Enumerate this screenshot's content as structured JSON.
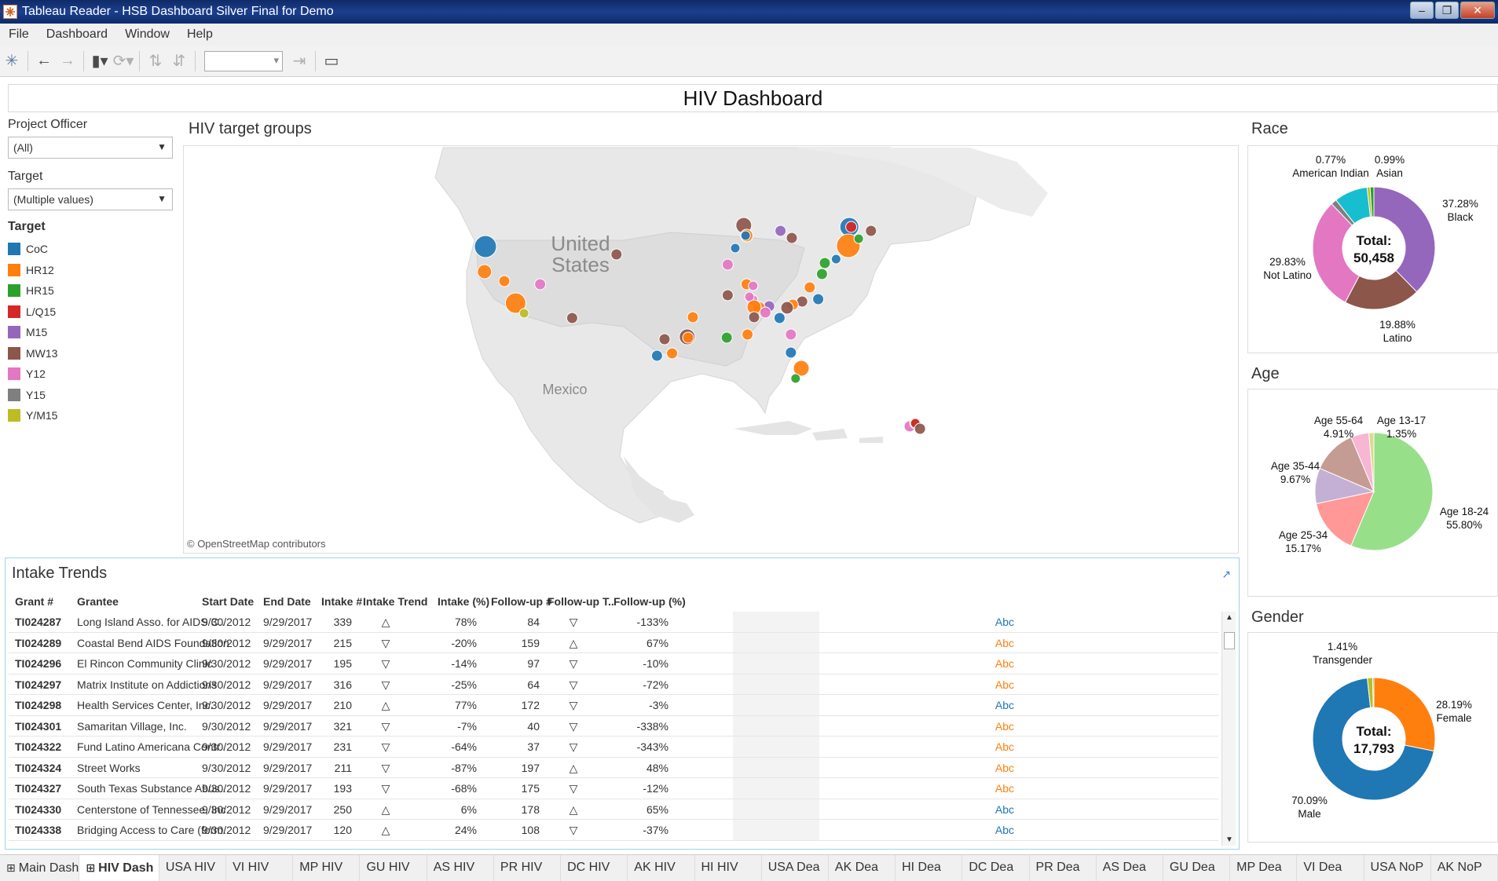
{
  "window": {
    "title": "Tableau Reader - HSB Dashboard Silver Final for Demo"
  },
  "menu": [
    "File",
    "Dashboard",
    "Window",
    "Help"
  ],
  "dashboard": {
    "title": "HIV Dashboard"
  },
  "filters": {
    "project_officer_label": "Project Officer",
    "project_officer_value": "(All)",
    "target_label": "Target",
    "target_value": "(Multiple values)",
    "legend_label": "Target",
    "legend": [
      {
        "name": "CoC",
        "color": "#1f77b4"
      },
      {
        "name": "HR12",
        "color": "#ff7f0e"
      },
      {
        "name": "HR15",
        "color": "#2ca02c"
      },
      {
        "name": "L/Q15",
        "color": "#d62728"
      },
      {
        "name": "M15",
        "color": "#9467bd"
      },
      {
        "name": "MW13",
        "color": "#8c564b"
      },
      {
        "name": "Y12",
        "color": "#e377c2"
      },
      {
        "name": "Y15",
        "color": "#7f7f7f"
      },
      {
        "name": "Y/M15",
        "color": "#bcbd22"
      }
    ]
  },
  "map": {
    "title": "HIV target groups",
    "labels": {
      "us_line1": "United",
      "us_line2": "States",
      "mexico": "Mexico"
    },
    "attribution": "© OpenStreetMap contributors"
  },
  "race": {
    "title": "Race",
    "total_label": "Total:",
    "total_value": "50,458",
    "slices": [
      {
        "name": "Black",
        "pct": "37.28%",
        "value": 37.28,
        "color": "#9467bd"
      },
      {
        "name": "Latino",
        "pct": "19.88%",
        "value": 19.88,
        "color": "#8c564b"
      },
      {
        "name": "Not Latino",
        "pct": "29.83%",
        "value": 29.83,
        "color": "#e377c2"
      },
      {
        "name": "",
        "pct": "",
        "value": 1.5,
        "color": "#7f7f7f"
      },
      {
        "name": "",
        "pct": "",
        "value": 8.75,
        "color": "#17becf"
      },
      {
        "name": "American Indian",
        "pct": "0.77%",
        "value": 0.77,
        "color": "#bcbd22"
      },
      {
        "name": "Asian",
        "pct": "0.99%",
        "value": 0.99,
        "color": "#2ca02c"
      }
    ]
  },
  "age": {
    "title": "Age",
    "slices": [
      {
        "name": "Age 18-24",
        "pct": "55.80%",
        "value": 55.8,
        "color": "#98df8a"
      },
      {
        "name": "Age 25-34",
        "pct": "15.17%",
        "value": 15.17,
        "color": "#ff9896"
      },
      {
        "name": "Age 35-44",
        "pct": "9.67%",
        "value": 9.67,
        "color": "#c5b0d5"
      },
      {
        "name": "",
        "pct": "",
        "value": 12.1,
        "color": "#c49c94"
      },
      {
        "name": "Age 55-64",
        "pct": "4.91%",
        "value": 4.91,
        "color": "#f7b6d2"
      },
      {
        "name": "Age 13-17",
        "pct": "1.35%",
        "value": 1.35,
        "color": "#dbdb8d"
      }
    ]
  },
  "gender": {
    "title": "Gender",
    "total_label": "Total:",
    "total_value": "17,793",
    "slices": [
      {
        "name": "Female",
        "pct": "28.19%",
        "value": 28.19,
        "color": "#ff7f0e"
      },
      {
        "name": "Male",
        "pct": "70.09%",
        "value": 70.09,
        "color": "#1f77b4"
      },
      {
        "name": "Transgender",
        "pct": "1.41%",
        "value": 1.41,
        "color": "#bcbd22"
      },
      {
        "name": "",
        "pct": "",
        "value": 0.31,
        "color": "#2ca02c"
      }
    ]
  },
  "trends": {
    "title": "Intake Trends",
    "columns": [
      "Grant #",
      "Grantee",
      "Start Date",
      "End Date",
      "Intake #",
      "Intake Trend",
      "Intake (%)",
      "Follow-up #",
      "Follow-up T..",
      "Follow-up (%)"
    ],
    "rows": [
      [
        "TI024287",
        "Long Island Asso. for AIDS C..",
        "9/30/2012",
        "9/29/2017",
        "339",
        "△",
        "78%",
        "84",
        "▽",
        "-133%",
        "Abc"
      ],
      [
        "TI024289",
        "Coastal Bend AIDS Foundation",
        "9/30/2012",
        "9/29/2017",
        "215",
        "▽",
        "-20%",
        "159",
        "△",
        "67%",
        "Abc"
      ],
      [
        "TI024296",
        "El Rincon Community Clinic",
        "9/30/2012",
        "9/29/2017",
        "195",
        "▽",
        "-14%",
        "97",
        "▽",
        "-10%",
        "Abc"
      ],
      [
        "TI024297",
        "Matrix Institute on Addictions",
        "9/30/2012",
        "9/29/2017",
        "316",
        "▽",
        "-25%",
        "64",
        "▽",
        "-72%",
        "Abc"
      ],
      [
        "TI024298",
        "Health Services Center, Inc.",
        "9/30/2012",
        "9/29/2017",
        "210",
        "△",
        "77%",
        "172",
        "▽",
        "-3%",
        "Abc"
      ],
      [
        "TI024301",
        "Samaritan Village, Inc.",
        "9/30/2012",
        "9/29/2017",
        "321",
        "▽",
        "-7%",
        "40",
        "▽",
        "-338%",
        "Abc"
      ],
      [
        "TI024322",
        "Fund Latino Americana Contr..",
        "9/30/2012",
        "9/29/2017",
        "231",
        "▽",
        "-64%",
        "37",
        "▽",
        "-343%",
        "Abc"
      ],
      [
        "TI024324",
        "Street Works",
        "9/30/2012",
        "9/29/2017",
        "211",
        "▽",
        "-87%",
        "197",
        "△",
        "48%",
        "Abc"
      ],
      [
        "TI024327",
        "South Texas Substance Abus..",
        "9/30/2012",
        "9/29/2017",
        "193",
        "▽",
        "-68%",
        "175",
        "▽",
        "-12%",
        "Abc"
      ],
      [
        "TI024330",
        "Centerstone of Tennessee, Inc.",
        "9/30/2012",
        "9/29/2017",
        "250",
        "△",
        "6%",
        "178",
        "△",
        "65%",
        "Abc"
      ],
      [
        "TI024338",
        "Bridging Access to Care (form..",
        "9/30/2012",
        "9/29/2017",
        "120",
        "△",
        "24%",
        "108",
        "▽",
        "-37%",
        "Abc"
      ]
    ]
  },
  "tabs": [
    "Main Dash",
    "HIV Dash",
    "USA HIV",
    "VI HIV",
    "MP HIV",
    "GU HIV",
    "AS HIV",
    "PR HIV",
    "DC HIV",
    "AK HIV",
    "HI HIV",
    "USA Dea",
    "AK Dea",
    "HI Dea",
    "DC Dea",
    "PR Dea",
    "AS Dea",
    "GU Dea",
    "MP Dea",
    "VI Dea",
    "USA NoP",
    "AK NoP"
  ],
  "active_tab": "HIV Dash"
}
